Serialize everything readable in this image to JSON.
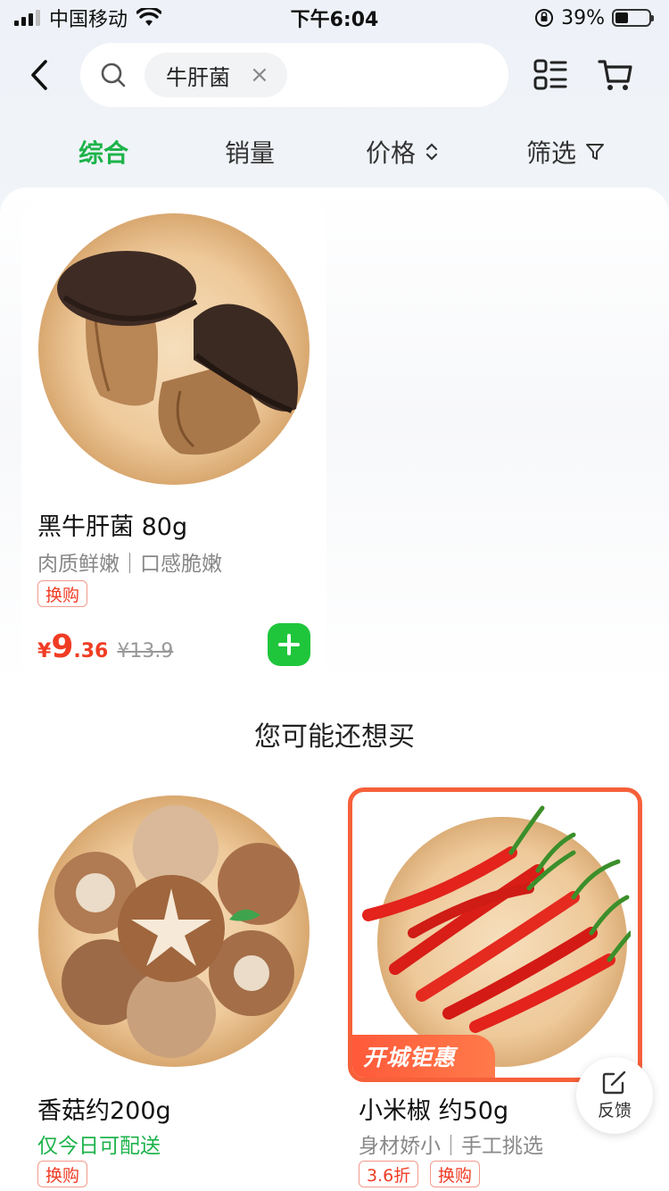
{
  "status_bar": {
    "carrier": "中国移动",
    "time": "下午6:04",
    "battery": "39%",
    "battery_level": 0.39
  },
  "header": {
    "search_term": "牛肝菌",
    "chip_close": "×"
  },
  "sort_tabs": [
    {
      "label": "综合",
      "active": true
    },
    {
      "label": "销量",
      "active": false
    },
    {
      "label": "价格",
      "active": false
    },
    {
      "label": "筛选",
      "active": false
    }
  ],
  "results": [
    {
      "title": "黑牛肝菌 80g",
      "subtitle": "肉质鲜嫩｜口感脆嫩",
      "tags": [
        "换购"
      ],
      "price_currency": "¥",
      "price_int": "9",
      "price_dec": ".36",
      "price_old": "¥13.9"
    }
  ],
  "recommend": {
    "title": "您可能还想买",
    "items": [
      {
        "title": "香菇约200g",
        "subtitle": "仅今日可配送",
        "tags": [
          "换购"
        ]
      },
      {
        "title": "小米椒 约50g",
        "subtitle": "身材娇小｜手工挑选",
        "tags": [
          "3.6折",
          "换购"
        ],
        "promo": "开城钜惠"
      }
    ]
  },
  "feedback": {
    "label": "反馈"
  },
  "colors": {
    "accent_green": "#1db34a",
    "price_red": "#f03c24",
    "add_button": "#1fc63b",
    "promo_orange": "#f6603a"
  }
}
